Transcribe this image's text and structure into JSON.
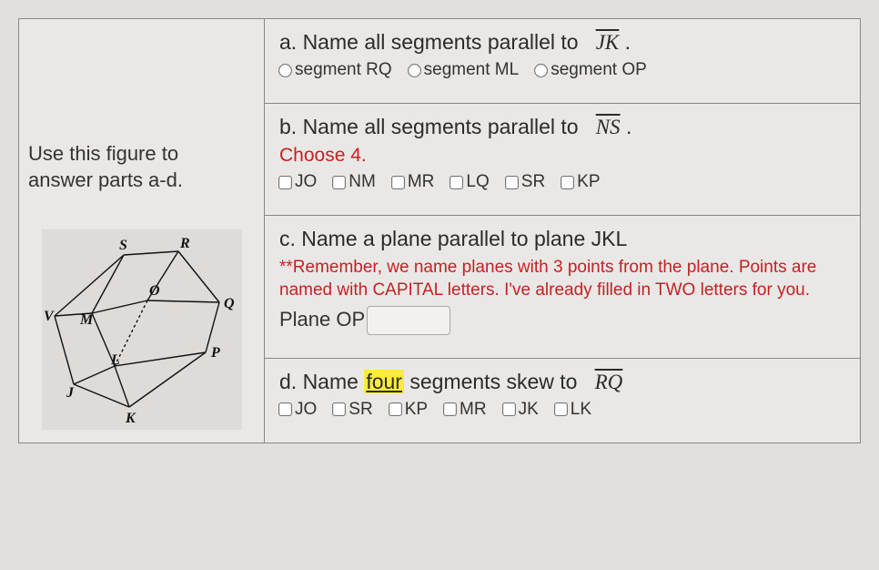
{
  "left": {
    "instruction_line1": "Use this figure to",
    "instruction_line2": "answer parts a-d.",
    "vertices": [
      "S",
      "R",
      "V",
      "M",
      "O",
      "Q",
      "J",
      "L",
      "P",
      "K"
    ]
  },
  "part_a": {
    "prompt_prefix": "a. Name all segments parallel to ",
    "segment": "JK",
    "options": [
      {
        "label": "segment RQ"
      },
      {
        "label": "segment ML"
      },
      {
        "label": "segment OP"
      }
    ]
  },
  "part_b": {
    "prompt_prefix": "b. Name all segments parallel to ",
    "segment": "NS",
    "sub_instruction": "Choose 4.",
    "options": [
      {
        "label": "JO"
      },
      {
        "label": "NM"
      },
      {
        "label": "MR"
      },
      {
        "label": "LQ"
      },
      {
        "label": "SR"
      },
      {
        "label": "KP"
      }
    ]
  },
  "part_c": {
    "prompt": "c. Name a plane parallel to plane JKL",
    "remember": "**Remember, we name planes with 3 points from the plane. Points are named with CAPITAL letters. I've already filled in TWO letters for you.",
    "answer_prefix": "Plane OP"
  },
  "part_d": {
    "prompt_prefix": "d. Name ",
    "highlight": "four",
    "prompt_suffix": " segments skew to ",
    "segment": "RQ",
    "options": [
      {
        "label": "JO"
      },
      {
        "label": "SR"
      },
      {
        "label": "KP"
      },
      {
        "label": "MR"
      },
      {
        "label": "JK"
      },
      {
        "label": "LK"
      }
    ]
  }
}
